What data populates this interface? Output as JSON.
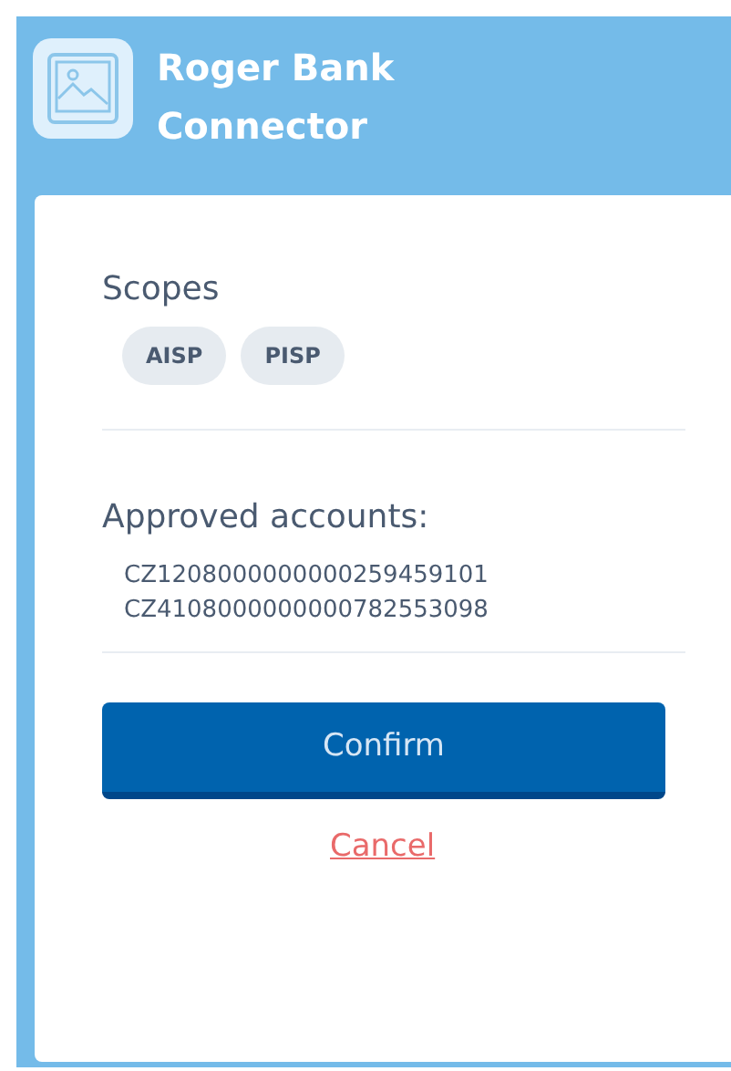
{
  "header": {
    "title": "Roger Bank Connector"
  },
  "scopes": {
    "heading": "Scopes",
    "tags": [
      "AISP",
      "PISP"
    ]
  },
  "accounts": {
    "heading": "Approved accounts:",
    "items": [
      "CZ1208000000000259459101",
      "CZ4108000000000782553098"
    ]
  },
  "actions": {
    "confirm": "Confirm",
    "cancel": "Cancel"
  }
}
